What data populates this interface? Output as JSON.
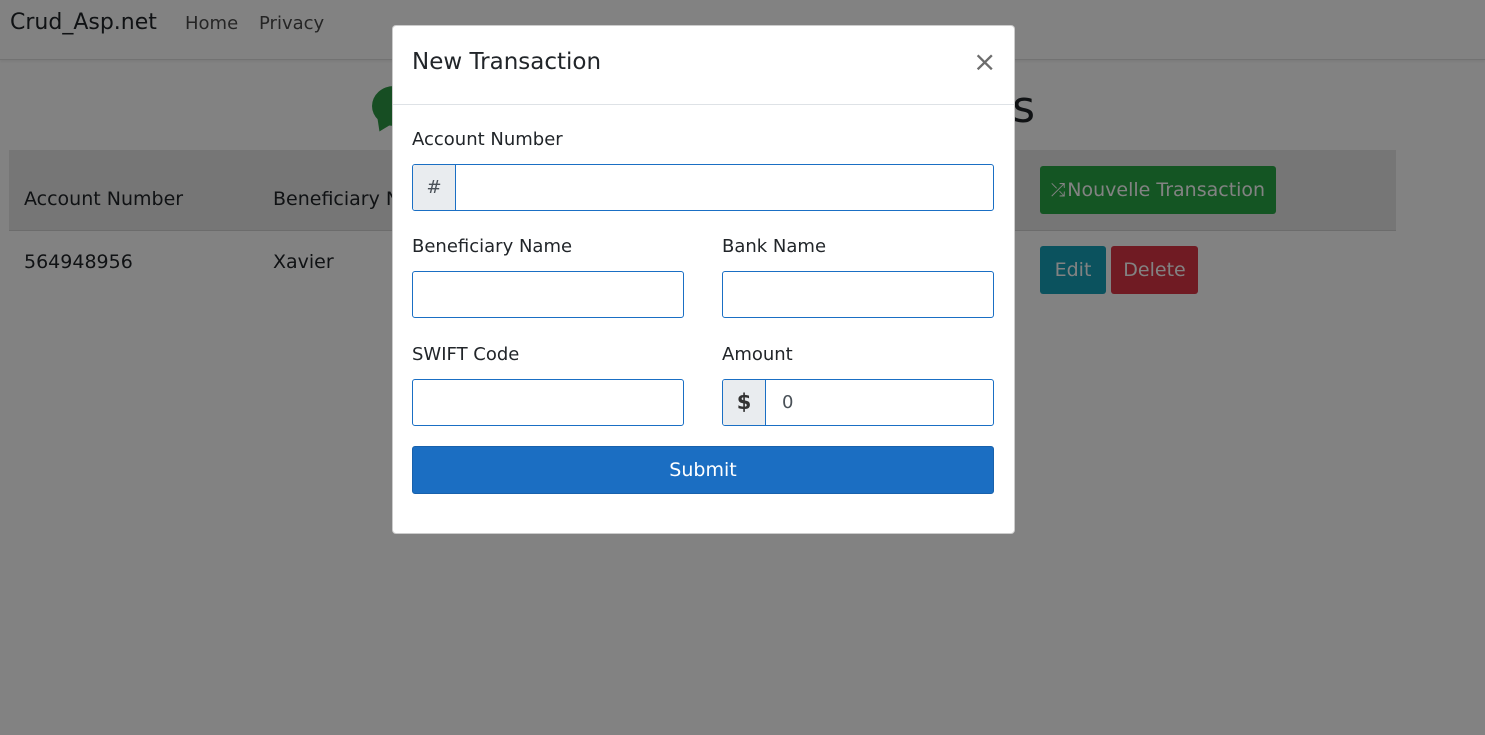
{
  "navbar": {
    "brand": "Crud_Asp.net",
    "links": [
      "Home",
      "Privacy"
    ]
  },
  "page": {
    "heading_visible_fragment": "s"
  },
  "table": {
    "headers": [
      "Account Number",
      "Beneficiary Na"
    ],
    "new_button_label": "Nouvelle Transaction",
    "rows": [
      {
        "account_number": "564948956",
        "beneficiary": "Xavier",
        "edit_label": "Edit",
        "delete_label": "Delete"
      }
    ]
  },
  "modal": {
    "title": "New Transaction",
    "close_glyph": "×",
    "fields": {
      "account_number": {
        "label": "Account Number",
        "addon": "#",
        "value": ""
      },
      "beneficiary_name": {
        "label": "Beneficiary Name",
        "value": ""
      },
      "bank_name": {
        "label": "Bank Name",
        "value": ""
      },
      "swift_code": {
        "label": "SWIFT Code",
        "value": ""
      },
      "amount": {
        "label": "Amount",
        "addon": "$",
        "value": "0"
      }
    },
    "submit_label": "Submit"
  },
  "colors": {
    "primary": "#1b6ec2",
    "success": "#28a745",
    "info": "#17a2b8",
    "danger": "#dc3545",
    "backdrop": "rgba(0,0,0,0.49)"
  },
  "icons": [
    "shuffle-icon",
    "chat-icon",
    "close-icon"
  ]
}
